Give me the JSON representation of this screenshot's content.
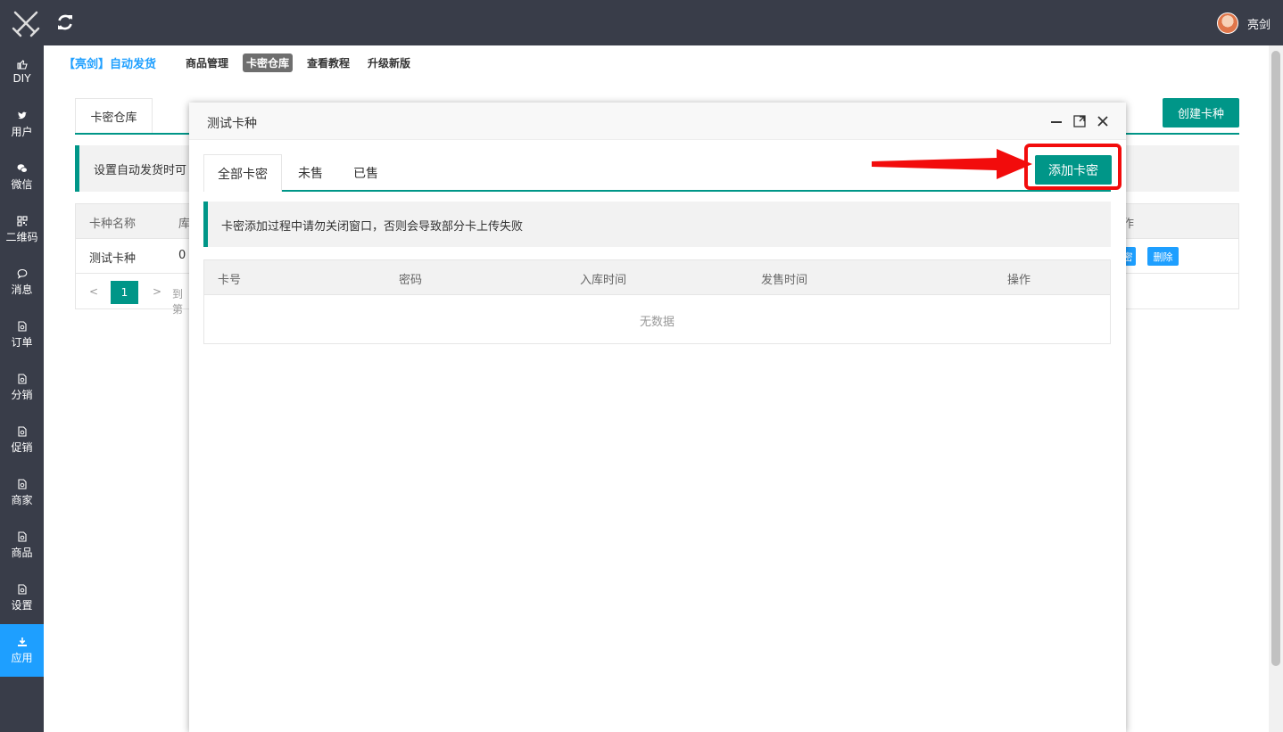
{
  "topbar": {
    "user_name": "亮剑"
  },
  "sidebar": {
    "items": [
      {
        "label": "DIY",
        "icon": "thumbs-up-icon"
      },
      {
        "label": "用户",
        "icon": "twitter-icon"
      },
      {
        "label": "微信",
        "icon": "wechat-icon"
      },
      {
        "label": "二维码",
        "icon": "qrcode-icon"
      },
      {
        "label": "消息",
        "icon": "chat-icon"
      },
      {
        "label": "订单",
        "icon": "file-icon"
      },
      {
        "label": "分销",
        "icon": "file-icon"
      },
      {
        "label": "促销",
        "icon": "file-icon"
      },
      {
        "label": "商家",
        "icon": "file-icon"
      },
      {
        "label": "商品",
        "icon": "file-icon"
      },
      {
        "label": "设置",
        "icon": "file-icon"
      },
      {
        "label": "应用",
        "icon": "download-icon"
      }
    ]
  },
  "header": {
    "brand": "【亮剑】自动发货",
    "nav": [
      "商品管理",
      "卡密仓库",
      "查看教程",
      "升级新版"
    ]
  },
  "page": {
    "tab": "卡密仓库",
    "create_button": "创建卡种",
    "notice": "设置自动发货时可",
    "table": {
      "headers": [
        "卡种名称",
        "库",
        "操作"
      ],
      "row": {
        "name": "测试卡种",
        "stock": "0",
        "btn_partial": "密",
        "btn_delete": "删除"
      }
    },
    "pager": {
      "current": "1",
      "goto_partial": "到第"
    }
  },
  "modal": {
    "title": "测试卡种",
    "tabs": [
      "全部卡密",
      "未售",
      "已售"
    ],
    "add_button": "添加卡密",
    "notice": "卡密添加过程中请勿关闭窗口，否则会导致部分卡上传失败",
    "table": {
      "headers": [
        "卡号",
        "密码",
        "入库时间",
        "发售时间",
        "操作"
      ],
      "empty": "无数据"
    }
  },
  "colors": {
    "accent": "#009688",
    "blue": "#1e9fff",
    "annotation": "#f20c0c"
  }
}
